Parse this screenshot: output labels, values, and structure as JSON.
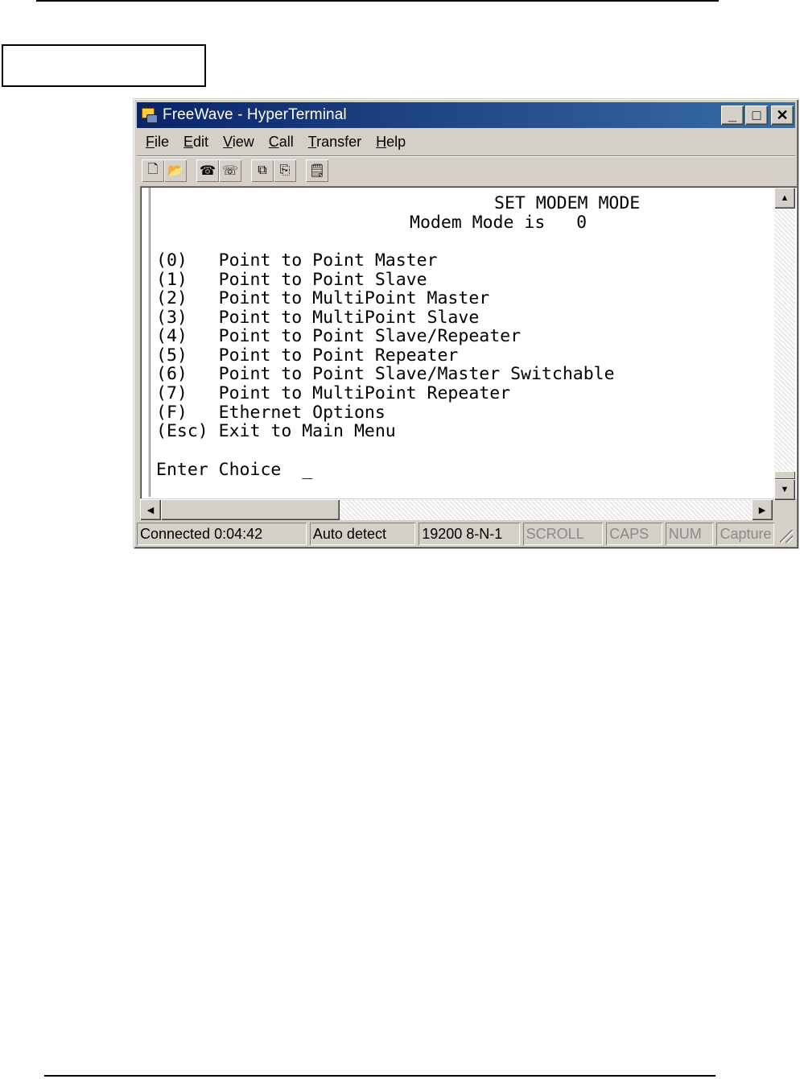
{
  "window": {
    "title": "FreeWave - HyperTerminal",
    "controls": {
      "minimize": "_",
      "maximize": "□",
      "close": "✕"
    }
  },
  "menu": [
    {
      "key": "F",
      "rest": "ile"
    },
    {
      "key": "E",
      "rest": "dit"
    },
    {
      "key": "V",
      "rest": "iew"
    },
    {
      "key": "C",
      "rest": "all"
    },
    {
      "key": "T",
      "rest": "ransfer"
    },
    {
      "key": "H",
      "rest": "elp"
    }
  ],
  "toolbar": {
    "icons": [
      "new-icon",
      "open-icon",
      "connect-icon",
      "disconnect-icon",
      "send-icon",
      "receive-icon",
      "properties-icon"
    ],
    "glyphs": [
      "🗋",
      "📂",
      "☎",
      "☏",
      "⧉",
      "⎘",
      "🗒"
    ]
  },
  "terminal": {
    "heading": "SET MODEM MODE",
    "mode_line": "Modem Mode is   0",
    "options": [
      "(0)   Point to Point Master",
      "(1)   Point to Point Slave",
      "(2)   Point to MultiPoint Master",
      "(3)   Point to MultiPoint Slave",
      "(4)   Point to Point Slave/Repeater",
      "(5)   Point to Point Repeater",
      "(6)   Point to Point Slave/Master Switchable",
      "(7)   Point to MultiPoint Repeater",
      "(F)   Ethernet Options",
      "(Esc) Exit to Main Menu"
    ],
    "prompt": "Enter Choice  _"
  },
  "scroll": {
    "up": "▲",
    "down": "▼",
    "left": "◀",
    "right": "▶"
  },
  "status": {
    "connected": "Connected 0:04:42",
    "detect": "Auto detect",
    "settings": "19200 8-N-1",
    "scroll": "SCROLL",
    "caps": "CAPS",
    "num": "NUM",
    "capture": "Capture"
  },
  "colors": {
    "titlebar_start": "#0a246a",
    "titlebar_end": "#3a6ea5",
    "chrome": "#d4d0c8"
  }
}
